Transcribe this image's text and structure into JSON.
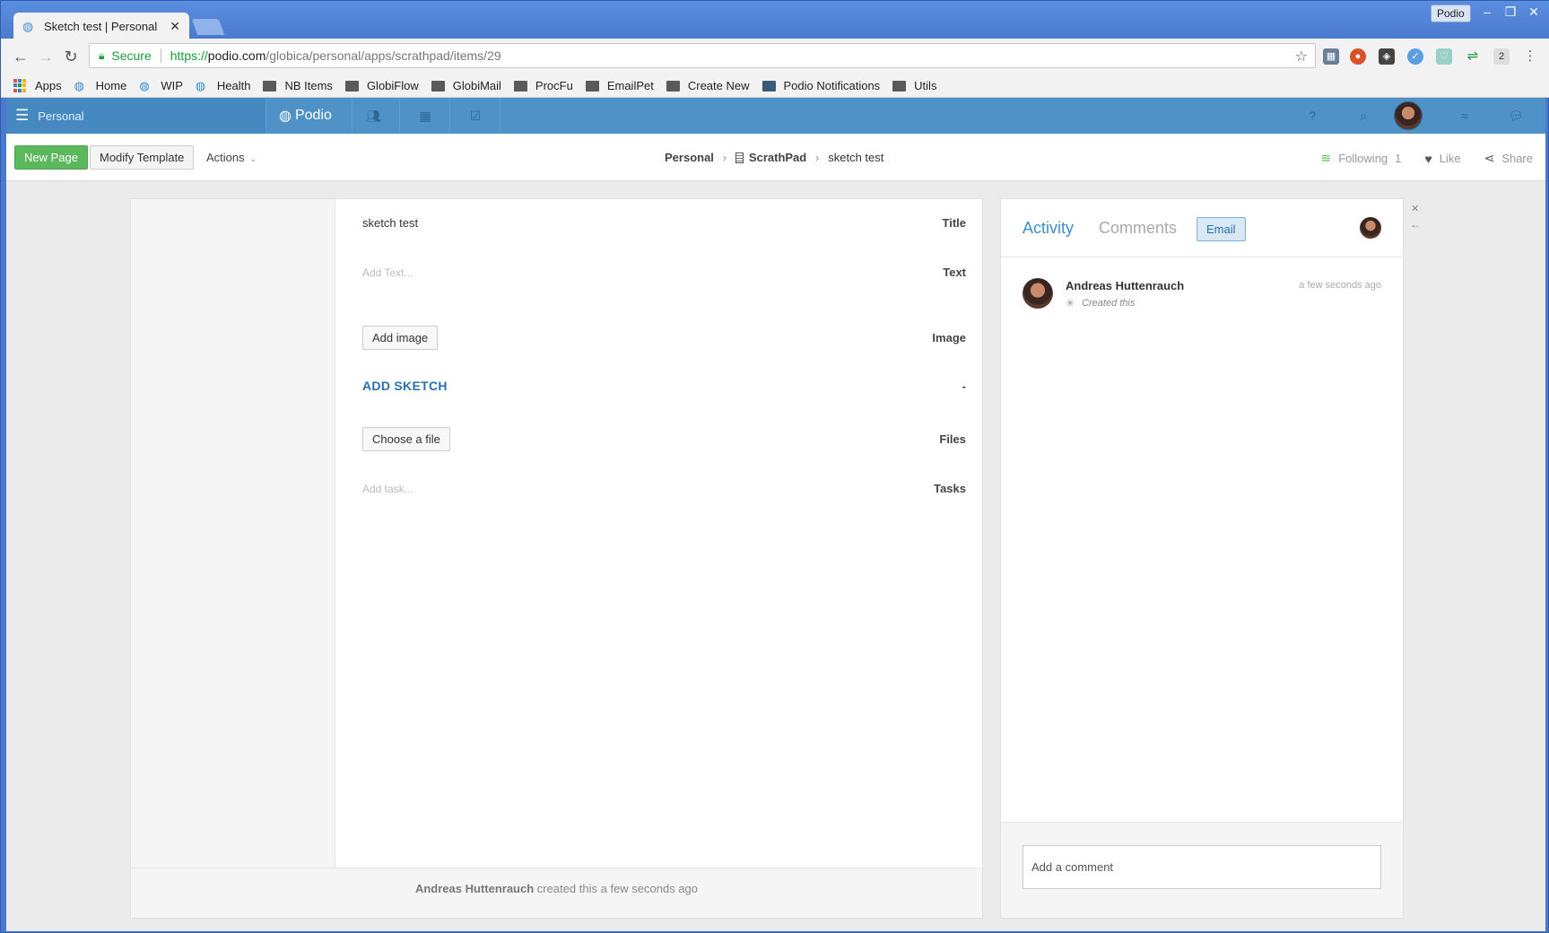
{
  "browser": {
    "tab_title": "Sketch test | Personal",
    "profile": "Podio",
    "secure_label": "Secure",
    "url_proto": "https://",
    "url_host": "podio.com",
    "url_path": "/globica/personal/apps/scrathpad/items/29",
    "extension_badge": "2"
  },
  "bookmarks": [
    {
      "label": "Apps",
      "icon": "apps-grid-icon"
    },
    {
      "label": "Home",
      "icon": "podio-icon"
    },
    {
      "label": "WIP",
      "icon": "podio-icon"
    },
    {
      "label": "Health",
      "icon": "podio-icon"
    },
    {
      "label": "NB Items",
      "icon": "folder-icon"
    },
    {
      "label": "GlobiFlow",
      "icon": "folder-icon"
    },
    {
      "label": "GlobiMail",
      "icon": "folder-icon"
    },
    {
      "label": "ProcFu",
      "icon": "folder-icon"
    },
    {
      "label": "EmailPet",
      "icon": "folder-icon"
    },
    {
      "label": "Create New",
      "icon": "folder-icon"
    },
    {
      "label": "Podio Notifications",
      "icon": "calculator-icon"
    },
    {
      "label": "Utils",
      "icon": "folder-icon"
    }
  ],
  "topnav": {
    "workspace": "Personal",
    "logo": "Podio"
  },
  "actionbar": {
    "new_page": "New Page",
    "modify_template": "Modify Template",
    "actions": "Actions",
    "breadcrumb": {
      "workspace": "Personal",
      "app": "ScrathPad",
      "item": "sketch test"
    },
    "following_label": "Following",
    "following_count": "1",
    "like": "Like",
    "share": "Share"
  },
  "item": {
    "fields": [
      {
        "label": "Title",
        "value": "sketch test"
      },
      {
        "label": "Text",
        "placeholder": "Add Text..."
      },
      {
        "label": "Image",
        "button": "Add image"
      },
      {
        "label": "-",
        "link": "ADD SKETCH"
      },
      {
        "label": "Files",
        "button": "Choose a file"
      },
      {
        "label": "Tasks",
        "placeholder": "Add task..."
      }
    ],
    "footer_author": "Andreas Huttenrauch",
    "footer_text": "created this a few seconds ago"
  },
  "side": {
    "tab_activity": "Activity",
    "tab_comments": "Comments",
    "email_button": "Email",
    "activity": {
      "author": "Andreas Huttenrauch",
      "time": "a few seconds ago",
      "description": "Created this"
    },
    "comment_placeholder": "Add a comment"
  },
  "colors": {
    "podio_blue": "#4f92c8",
    "green_button": "#5cb85c",
    "link_blue": "#2b6fb0"
  }
}
